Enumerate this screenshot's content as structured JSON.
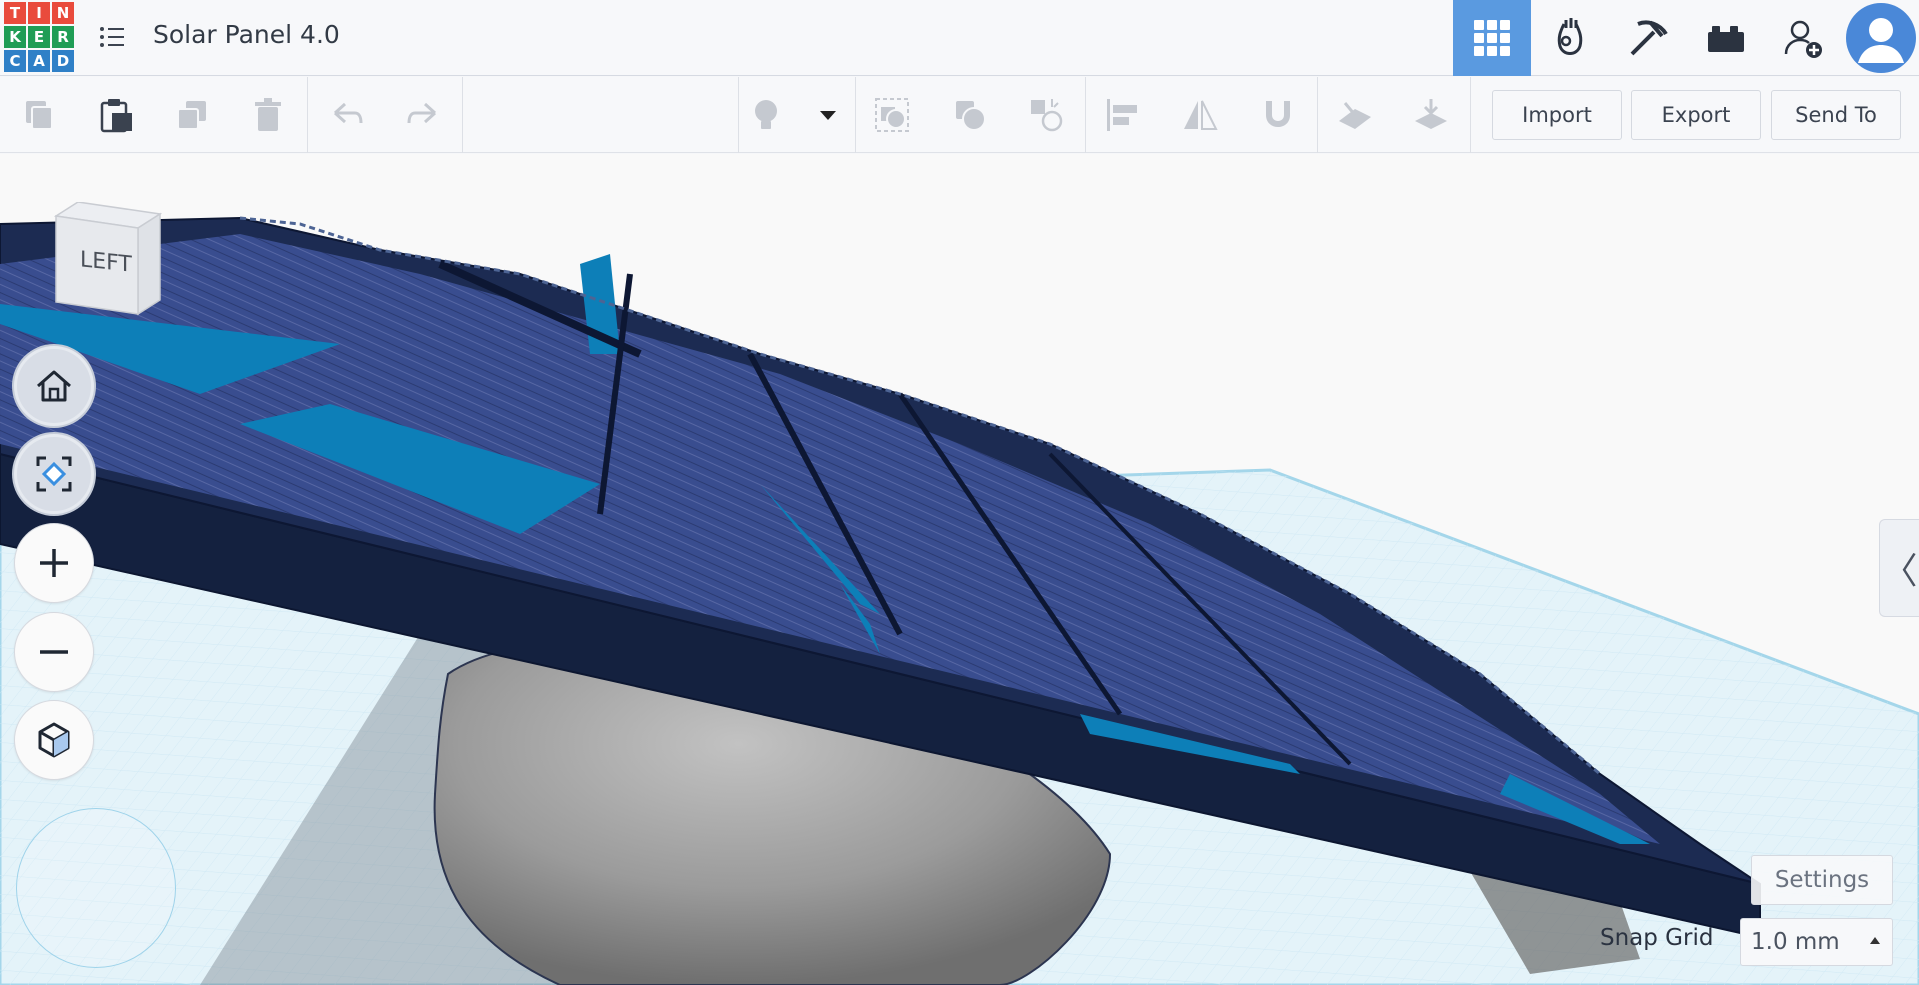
{
  "app": {
    "logo_letters": [
      "T",
      "I",
      "N",
      "K",
      "E",
      "R",
      "C",
      "A",
      "D"
    ],
    "logo_colors": [
      "#e94b3c",
      "#e94b3c",
      "#e94b3c",
      "#1f9d55",
      "#1f9d55",
      "#1f9d55",
      "#2f80c7",
      "#2f80c7",
      "#2f80c7"
    ],
    "title": "Solar Panel 4.0"
  },
  "header": {
    "icons": [
      "grid-view-icon",
      "sim-lab-icon",
      "bricks-pickaxe-icon",
      "lego-bricks-icon",
      "add-user-icon",
      "user-avatar"
    ],
    "accent": "#5a9ae0"
  },
  "toolbar": {
    "buttons": [
      "copy",
      "paste",
      "duplicate",
      "delete",
      "undo",
      "redo",
      "light-bulb",
      "dropdown",
      "group",
      "ungroup",
      "hole",
      "align",
      "mirror",
      "cruise",
      "workplane",
      "ruler",
      "drop"
    ],
    "import_label": "Import",
    "export_label": "Export",
    "send_to_label": "Send To"
  },
  "view_cube": {
    "face_label": "LEFT"
  },
  "side_panel": {
    "toggle_label": "〈"
  },
  "settings": {
    "label": "Settings"
  },
  "snap_grid": {
    "label": "Snap Grid",
    "value": "1.0 mm"
  },
  "colors": {
    "panel_frame": "#14213f",
    "panel_cells": "#3b4f92",
    "panel_gaps": "#0d7fb8",
    "dome": "#9a9a9a",
    "grid": "#cfe8f4"
  }
}
